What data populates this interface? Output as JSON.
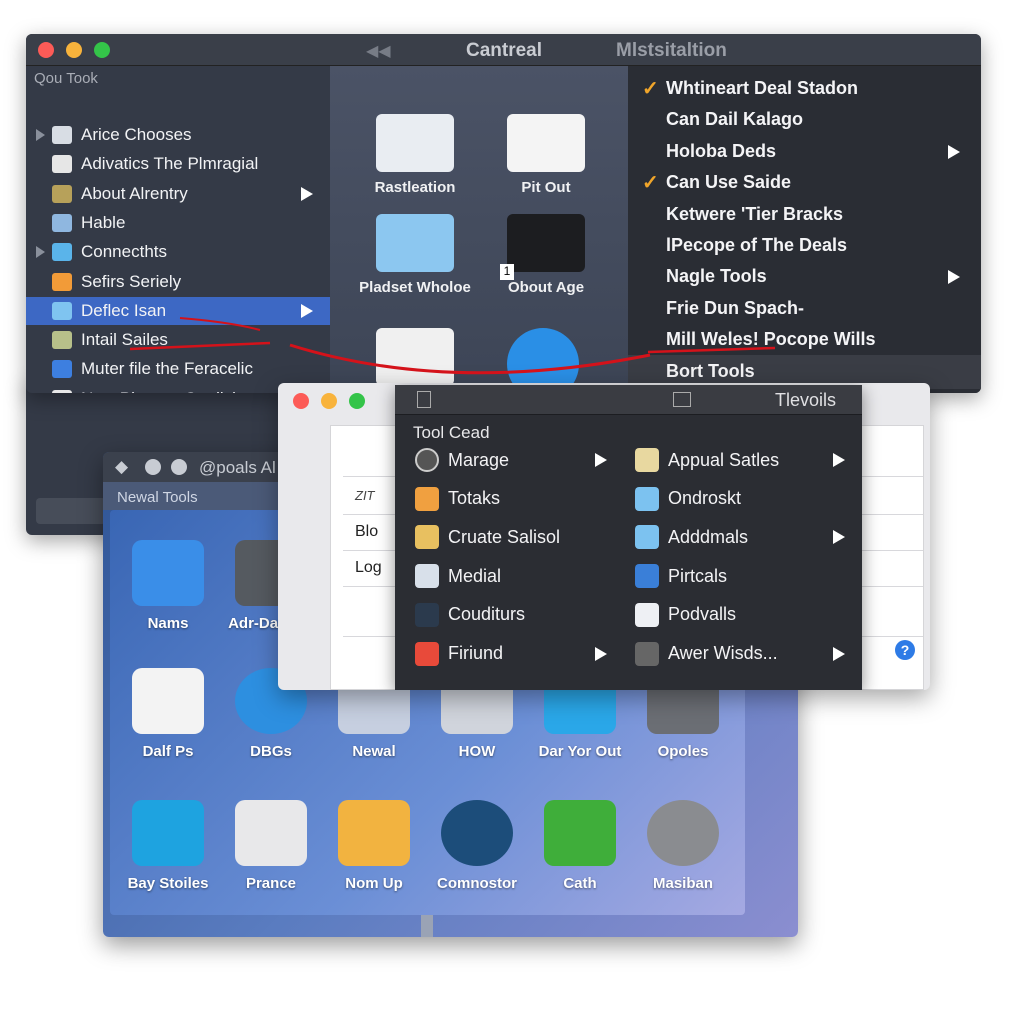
{
  "main_window": {
    "title": "Cantreal",
    "title_right": "Mlstsitaltion",
    "sidebar": {
      "section": "Qou Took",
      "items": [
        {
          "label": "Arice Chooses",
          "disclosure": true,
          "icon": "chart-icon"
        },
        {
          "label": "Adivatics The Plmragial",
          "icon": "document-icon"
        },
        {
          "label": "About Alrentry",
          "submenu": true,
          "icon": "brush-icon"
        },
        {
          "label": "Hable",
          "icon": "mailbox-icon"
        },
        {
          "label": "Connecthts",
          "disclosure": true,
          "icon": "folder-icon"
        },
        {
          "label": "Sefirs Seriely",
          "icon": "orange-circle-icon"
        },
        {
          "label": "Deflec Isan",
          "submenu": true,
          "selected": true,
          "icon": "disk-icon"
        },
        {
          "label": "Intail Sailes",
          "icon": "installer-icon"
        },
        {
          "label": "Muter file the Feracelic",
          "icon": "gear-badge-icon"
        },
        {
          "label": "New Phrapor Stralisl",
          "submenu": true,
          "icon": "arrow-up-icon"
        }
      ]
    },
    "grid": [
      {
        "label": "Rastleation",
        "icon": "spreadsheet-icon"
      },
      {
        "label": "Pit Out",
        "icon": "document-icon"
      },
      {
        "label": "Pladset Wholoe",
        "icon": "z-folder-icon"
      },
      {
        "label": "Obout Age",
        "icon": "ring-chart-icon",
        "badge": "1"
      },
      {
        "label": "",
        "icon": "color-palette-icon"
      },
      {
        "label": "",
        "icon": "compass-icon"
      }
    ],
    "menu": [
      {
        "label": "Whtineart Deal Stadon",
        "checked": true
      },
      {
        "label": "Can Dail Kalago"
      },
      {
        "label": "Holoba Deds",
        "submenu": true
      },
      {
        "label": "Can Use Saide",
        "checked": true
      },
      {
        "label": "Ketwere 'Tier Bracks"
      },
      {
        "label": "lPecope of The Deals"
      },
      {
        "label": "Nagle Tools",
        "submenu": true
      },
      {
        "label": "Frie Dun Spach-"
      },
      {
        "label": "Mill Weles! Pocope Wills"
      },
      {
        "label": "Bort Tools",
        "highlighted": true
      }
    ]
  },
  "tools_window": {
    "title": "Tlevoils",
    "header": "Tool Cead",
    "left_rows": [
      "ZIT",
      "Blo",
      "Log"
    ],
    "col1": [
      {
        "label": "Marage",
        "submenu": true,
        "icon": "power-icon"
      },
      {
        "label": "Totaks",
        "icon": "finder-icon"
      },
      {
        "label": "Cruate Salisol",
        "icon": "photo-icon"
      },
      {
        "label": "Medial",
        "icon": "notes-icon"
      },
      {
        "label": "Couditurs",
        "icon": "dark-app-icon"
      },
      {
        "label": "Firiund",
        "submenu": true,
        "icon": "red-app-icon"
      }
    ],
    "col2": [
      {
        "label": "Appual Satles",
        "submenu": true,
        "icon": "preview-icon"
      },
      {
        "label": "Ondroskt",
        "icon": "folder-icon"
      },
      {
        "label": "Adddmals",
        "submenu": true,
        "icon": "folder-icon"
      },
      {
        "label": "Pirtcals",
        "icon": "photo-booth-icon"
      },
      {
        "label": "Podvalls",
        "icon": "document-icon"
      },
      {
        "label": "Awer Wisds...",
        "submenu": true,
        "icon": "drill-icon"
      }
    ]
  },
  "apps_window": {
    "title": "@poals Al",
    "subtitle": "Newal Tools",
    "apps": [
      {
        "label": "Nams",
        "icon": "mail-icon",
        "color": "#3a8ee8"
      },
      {
        "label": "Adr-Dafions",
        "icon": "speaker-icon",
        "color": "#555a60"
      },
      {
        "label": "Dalf Ps",
        "icon": "document-icon",
        "color": "#f3f3f3"
      },
      {
        "label": "DBGs",
        "icon": "compass-icon",
        "color": "#2d8fe0"
      },
      {
        "label": "Newal",
        "icon": "arrow-down-icon",
        "color": "#c6cfe0"
      },
      {
        "label": "HOW",
        "icon": "tool-icon",
        "color": "#d0d4dc"
      },
      {
        "label": "Dar Yor Out",
        "icon": "mail-icon",
        "color": "#2aa7e8"
      },
      {
        "label": "Opoles",
        "icon": "printer-icon",
        "color": "#6b6e74"
      },
      {
        "label": "Bay Stoiles",
        "icon": "windows-icon",
        "color": "#1ea3e0"
      },
      {
        "label": "Prance",
        "icon": "safari-icon",
        "color": "#e8e8ea"
      },
      {
        "label": "Nom Up",
        "icon": "folder-icon",
        "color": "#f2b340"
      },
      {
        "label": "Comnostor",
        "icon": "globe-icon",
        "color": "#1c4d7a"
      },
      {
        "label": "Cath",
        "icon": "badge-icon",
        "color": "#3fae3a"
      },
      {
        "label": "Masiban",
        "icon": "gear-icon",
        "color": "#8a8c90"
      }
    ]
  },
  "colors": {
    "selection": "#3d68c4",
    "check": "#f0a52a",
    "annotation": "#d4121a"
  }
}
